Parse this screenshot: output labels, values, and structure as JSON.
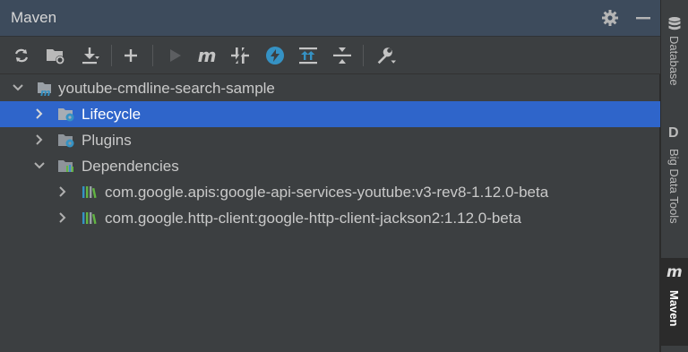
{
  "window": {
    "title": "Maven"
  },
  "toolbar": {
    "icons": [
      "reload-icon",
      "generate-sources-icon",
      "download-icon",
      "add-icon",
      "run-icon",
      "maven-goal-icon",
      "skip-tests-icon",
      "offline-icon",
      "show-dependencies-icon",
      "collapse-all-icon",
      "settings-wrench-icon"
    ]
  },
  "tree": {
    "project": "youtube-cmdline-search-sample",
    "lifecycle": "Lifecycle",
    "plugins": "Plugins",
    "dependencies": "Dependencies",
    "dep1": "com.google.apis:google-api-services-youtube:v3-rev8-1.12.0-beta",
    "dep2": "com.google.http-client:google-http-client-jackson2:1.12.0-beta"
  },
  "stripe": {
    "database": "Database",
    "bigdata_letter": "D",
    "bigdata": "Big Data Tools",
    "maven_letter": "m",
    "maven": "Maven"
  },
  "colors": {
    "selection": "#2f65ca",
    "header": "#3d4b5c",
    "background": "#3c3f41",
    "accent_blue": "#3592c4"
  }
}
